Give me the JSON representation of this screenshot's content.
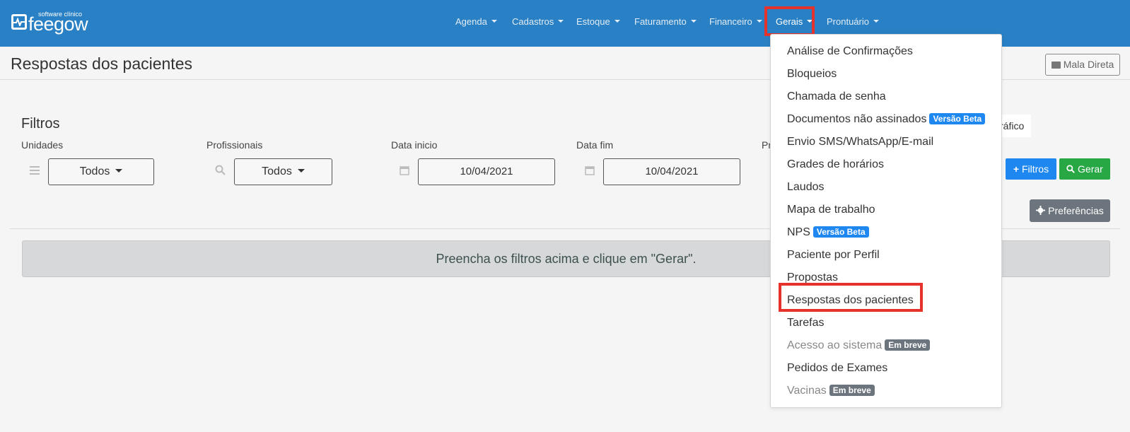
{
  "brand": {
    "subtitle": "software clínico",
    "name": "feegow"
  },
  "nav": [
    "Agenda",
    "Cadastros",
    "Estoque",
    "Faturamento",
    "Financeiro",
    "Gerais",
    "Prontuário"
  ],
  "page": {
    "title": "Respostas dos pacientes",
    "mala_direta": "Mala Direta"
  },
  "filters": {
    "title": "Filtros",
    "unidades": {
      "label": "Unidades",
      "value": "Todos"
    },
    "profissionais": {
      "label": "Profissionais",
      "value": "Todos"
    },
    "data_inicio": {
      "label": "Data inicio",
      "value": "10/04/2021"
    },
    "data_fim": {
      "label": "Data fim",
      "value": "10/04/2021"
    },
    "partial_label": "Pr",
    "grafico_partial": "ráfico"
  },
  "actions": {
    "filtros": "Filtros",
    "gerar": "Gerar",
    "preferencias": "Preferências"
  },
  "alert": "Preencha os filtros acima e clique em \"Gerar\".",
  "menu": [
    {
      "label": "Análise de Confirmações"
    },
    {
      "label": "Bloqueios"
    },
    {
      "label": "Chamada de senha"
    },
    {
      "label": "Documentos não assinados",
      "badge": "Versão Beta"
    },
    {
      "label": "Envio SMS/WhatsApp/E-mail"
    },
    {
      "label": "Grades de horários"
    },
    {
      "label": "Laudos"
    },
    {
      "label": "Mapa de trabalho"
    },
    {
      "label": "NPS",
      "badge": "Versão Beta"
    },
    {
      "label": "Paciente por Perfil"
    },
    {
      "label": "Propostas"
    },
    {
      "label": "Respostas dos pacientes"
    },
    {
      "label": "Tarefas"
    },
    {
      "label": "Acesso ao sistema",
      "badge": "Em breve"
    },
    {
      "label": "Pedidos de Exames"
    },
    {
      "label": "Vacinas",
      "badge": "Em breve"
    }
  ],
  "colors": {
    "navbar": "#2980c4",
    "highlight": "#e5322d",
    "beta_badge": "#1e87f0",
    "soon_badge": "#6c757d",
    "gerar": "#28a745"
  }
}
